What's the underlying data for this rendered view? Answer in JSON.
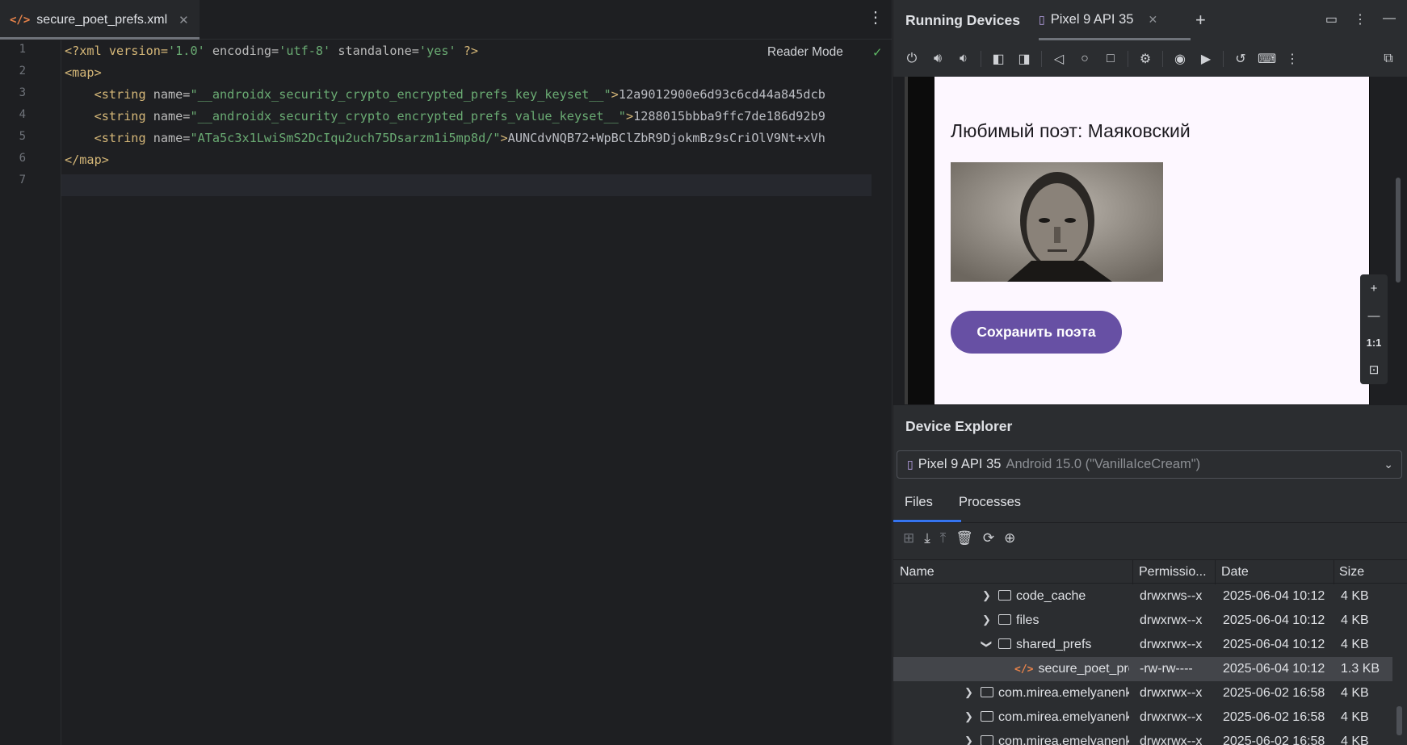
{
  "editor": {
    "tab_label": "secure_poet_prefs.xml",
    "tab_close": "✕",
    "menu_glyph": "⋮",
    "reader_mode": "Reader Mode",
    "check_glyph": "✓",
    "line_numbers": [
      "1",
      "2",
      "3",
      "4",
      "5",
      "6",
      "7"
    ],
    "lines": {
      "l1": {
        "a": "<?xml version=",
        "b": "'1.0'",
        "c": " encoding=",
        "d": "'utf-8'",
        "e": " standalone=",
        "f": "'yes'",
        "g": " ?>"
      },
      "l2": {
        "a": "<map>"
      },
      "l3": {
        "indent": "    ",
        "tag": "<string",
        "attr": " name=",
        "val": "\"__androidx_security_crypto_encrypted_prefs_key_keyset__\"",
        "end": ">",
        "text": "12a9012900e6d93c6cd44a845dcb"
      },
      "l4": {
        "indent": "    ",
        "tag": "<string",
        "attr": " name=",
        "val": "\"__androidx_security_crypto_encrypted_prefs_value_keyset__\"",
        "end": ">",
        "text": "1288015bbba9ffc7de186d92b9"
      },
      "l5": {
        "indent": "    ",
        "tag": "<string",
        "attr": " name=",
        "val": "\"ATa5c3x1LwiSmS2DcIqu2uch75Dsarzm1i5mp8d/\"",
        "end": ">",
        "text": "AUNCdvNQB72+WpBClZbR9DjokmBz9sCriOlV9Nt+xVh"
      },
      "l6": {
        "a": "</map>"
      }
    }
  },
  "running_devices": {
    "title": "Running Devices",
    "device_tab": "Pixel 9 API 35",
    "tab_close": "✕",
    "add_glyph": "+",
    "toolbar_icons": [
      "power-icon",
      "volume-up-icon",
      "volume-down-icon",
      "rotate-left-icon",
      "rotate-right-icon",
      "back-icon",
      "home-icon",
      "overview-icon",
      "device-settings-icon",
      "screenshot-icon",
      "screen-record-icon",
      "reset-icon",
      "keyboard-icon",
      "more-icon"
    ],
    "screen": {
      "poet_text": "Любимый поэт: Маяковский",
      "save_button": "Сохранить поэта"
    },
    "zoom": {
      "plus": "+",
      "minus": "—",
      "one_to_one": "1:1"
    }
  },
  "device_explorer": {
    "title": "Device Explorer",
    "device_name": "Pixel 9 API 35",
    "device_version": "Android 15.0 (\"VanillaIceCream\")",
    "tabs": [
      "Files",
      "Processes"
    ],
    "columns": [
      "Name",
      "Permissio...",
      "Date",
      "Size"
    ],
    "rows": [
      {
        "name": "code_cache",
        "perm": "drwxrws--x",
        "date": "2025-06-04 10:12",
        "size": "4 KB"
      },
      {
        "name": "files",
        "perm": "drwxrwx--x",
        "date": "2025-06-04 10:12",
        "size": "4 KB"
      },
      {
        "name": "shared_prefs",
        "perm": "drwxrwx--x",
        "date": "2025-06-04 10:12",
        "size": "4 KB"
      },
      {
        "name": "secure_poet_prefs.xml",
        "perm": "-rw-rw----",
        "date": "2025-06-04 10:12",
        "size": "1.3 KB"
      },
      {
        "name": "com.mirea.emelyanenko",
        "perm": "drwxrwx--x",
        "date": "2025-06-02 16:58",
        "size": "4 KB"
      },
      {
        "name": "com.mirea.emelyanenko",
        "perm": "drwxrwx--x",
        "date": "2025-06-02 16:58",
        "size": "4 KB"
      },
      {
        "name": "com.mirea.emelyanenko",
        "perm": "drwxrwx--x",
        "date": "2025-06-02 16:58",
        "size": "4 KB"
      }
    ]
  },
  "colors": {
    "accent": "#3574f0",
    "button_purple": "#6750a4",
    "xml_tag": "#d5b778",
    "xml_value": "#6aab73"
  }
}
